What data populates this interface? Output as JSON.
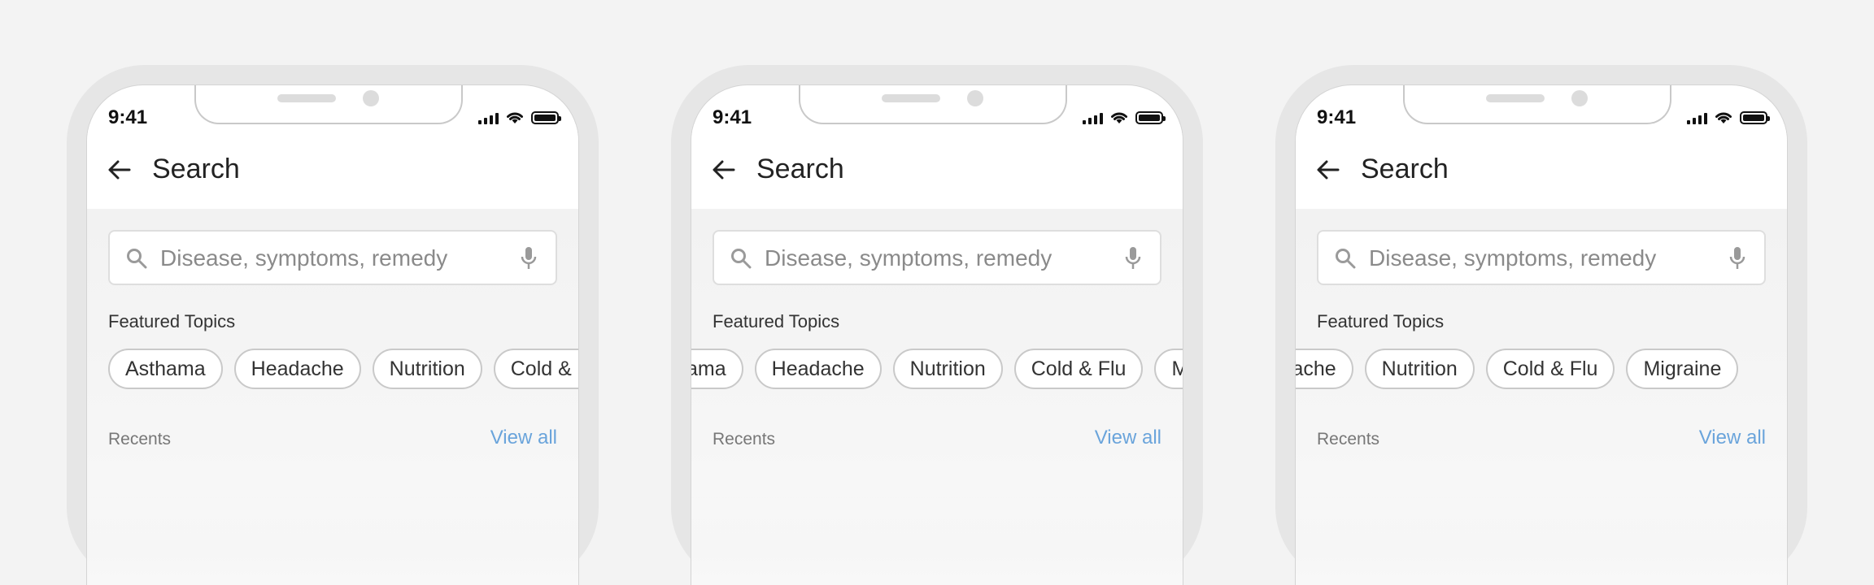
{
  "status_bar": {
    "time": "9:41"
  },
  "header": {
    "title": "Search"
  },
  "search": {
    "placeholder": "Disease, symptoms, remedy"
  },
  "featured": {
    "title": "Featured Topics",
    "topics": [
      "Asthama",
      "Headache",
      "Nutrition",
      "Cold & Flu",
      "Migraine"
    ]
  },
  "recents": {
    "title": "Recents",
    "view_all": "View all"
  },
  "colors": {
    "accent": "#6aa4db",
    "text": "#222222",
    "chip_border": "#c9c9c9"
  },
  "icons": [
    "back-arrow-icon",
    "search-icon",
    "microphone-icon",
    "cellular-signal-icon",
    "wifi-icon",
    "battery-icon"
  ]
}
